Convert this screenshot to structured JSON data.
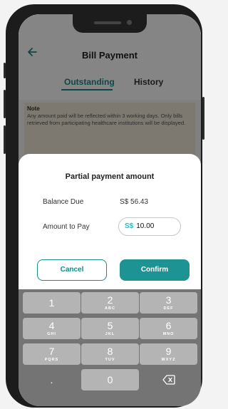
{
  "header": {
    "title": "Bill Payment"
  },
  "tabs": [
    {
      "label": "Outstanding",
      "active": true
    },
    {
      "label": "History",
      "active": false
    }
  ],
  "note": {
    "title": "Note",
    "text": "Any amount paid will be reflected within 3 working days. Only bills retrieved from participating healthcare institutions will be displayed."
  },
  "background_caption": "",
  "modal": {
    "title": "Partial payment amount",
    "balance_label": "Balance Due",
    "balance_value": "S$ 56.43",
    "amount_label": "Amount to Pay",
    "currency": "S$",
    "amount_value": "10.00",
    "cancel_label": "Cancel",
    "confirm_label": "Confirm"
  },
  "keypad": {
    "k1": {
      "num": "1",
      "letters": ""
    },
    "k2": {
      "num": "2",
      "letters": "ABC"
    },
    "k3": {
      "num": "3",
      "letters": "DEF"
    },
    "k4": {
      "num": "4",
      "letters": "GHI"
    },
    "k5": {
      "num": "5",
      "letters": "JKL"
    },
    "k6": {
      "num": "6",
      "letters": "MNO"
    },
    "k7": {
      "num": "7",
      "letters": "PQRS"
    },
    "k8": {
      "num": "8",
      "letters": "TUV"
    },
    "k9": {
      "num": "9",
      "letters": "WXYZ"
    },
    "k0": {
      "num": "0"
    },
    "dot": "."
  },
  "colors": {
    "accent": "#1a8a8a",
    "confirm_bg": "#1d9393",
    "currency": "#36b7c0"
  }
}
